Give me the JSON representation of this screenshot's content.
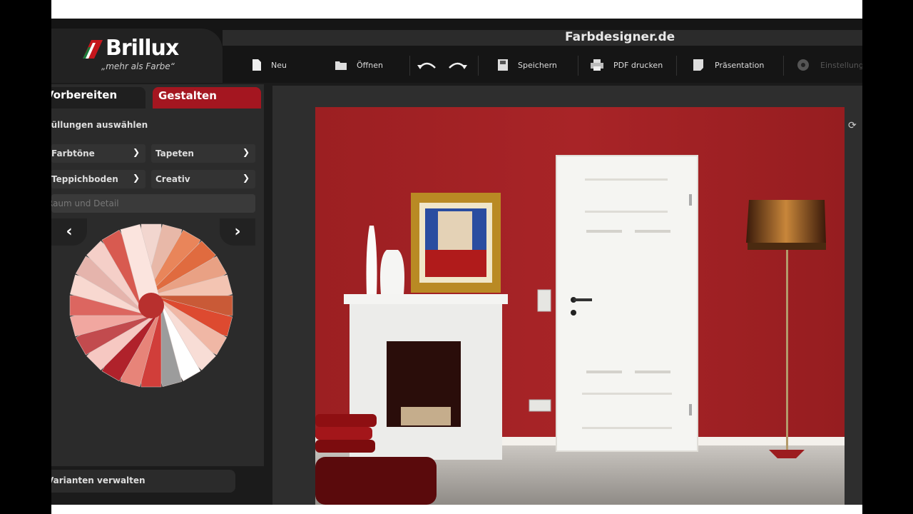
{
  "app": {
    "title": "Farbdesigner.de",
    "brand": "Brillux",
    "tagline": "„mehr als Farbe“"
  },
  "toolbar": {
    "new_label": "Neu",
    "open_label": "Öffnen",
    "undo_icon": "undo-icon",
    "redo_icon": "redo-icon",
    "save_label": "Speichern",
    "pdf_label": "PDF drucken",
    "presentation_label": "Präsentation",
    "extra_label": "Einstellungen"
  },
  "tabs": {
    "prepare": "Vorbereiten",
    "design": "Gestalten"
  },
  "sidebar": {
    "section_title": "Füllungen auswählen",
    "dropdowns": {
      "color_tones": "Farbtöne",
      "wallpapers": "Tapeten",
      "carpet": "Teppichboden",
      "creative": "Creativ"
    },
    "detail_placeholder": "Raum und Detail",
    "prev_label": "‹",
    "next_label": "›",
    "variants": "Varianten verwalten"
  },
  "colors": {
    "accent_red": "#a41620",
    "wall_red": "#a02124"
  }
}
